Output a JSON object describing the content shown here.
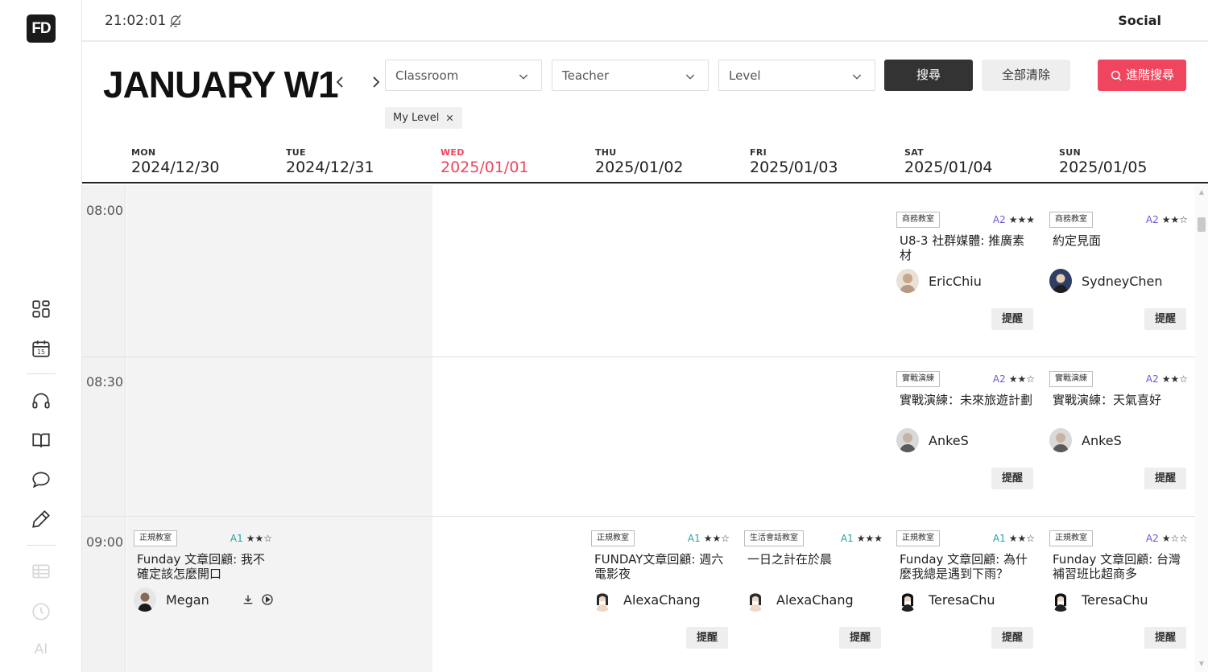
{
  "sidebar": {
    "logo": "FD",
    "ai_label": "AI",
    "icons": [
      "dashboard-icon",
      "calendar-icon",
      "headphones-icon",
      "book-icon",
      "chat-icon",
      "pencil-icon",
      "table-icon",
      "clock-icon"
    ]
  },
  "topbar": {
    "time": "21:02:01",
    "social": "Social"
  },
  "toolbar": {
    "week_title": "JANUARY W1",
    "classroom_placeholder": "Classroom",
    "teacher_placeholder": "Teacher",
    "level_placeholder": "Level",
    "search_label": "搜尋",
    "clear_label": "全部清除",
    "advanced_label": "進階搜尋",
    "chip_label": "My Level"
  },
  "days": [
    {
      "name": "MON",
      "date": "2024/12/30"
    },
    {
      "name": "TUE",
      "date": "2024/12/31"
    },
    {
      "name": "WED",
      "date": "2025/01/01"
    },
    {
      "name": "THU",
      "date": "2025/01/02"
    },
    {
      "name": "FRI",
      "date": "2025/01/03"
    },
    {
      "name": "SAT",
      "date": "2025/01/04"
    },
    {
      "name": "SUN",
      "date": "2025/01/05"
    }
  ],
  "times": [
    "08:00",
    "08:30",
    "09:00"
  ],
  "remind_label": "提醒",
  "cards": [
    {
      "tag": "商務教室",
      "level": "A2",
      "stars": "★★★",
      "title": "U8-3 社群媒體: 推廣素材",
      "teacher": "EricChiu"
    },
    {
      "tag": "商務教室",
      "level": "A2",
      "stars": "★★☆",
      "title": "約定見面",
      "teacher": "SydneyChen"
    },
    {
      "tag": "實戰演練",
      "level": "A2",
      "stars": "★★☆",
      "title": "實戰演練：未來旅遊計劃",
      "teacher": "AnkeS"
    },
    {
      "tag": "實戰演練",
      "level": "A2",
      "stars": "★★☆",
      "title": "實戰演練：天氣喜好",
      "teacher": "AnkeS"
    },
    {
      "tag": "正規教室",
      "level": "A1",
      "stars": "★★☆",
      "title": "Funday 文章回顧: 我不確定該怎麼開口",
      "teacher": "Megan"
    },
    {
      "tag": "正規教室",
      "level": "A1",
      "stars": "★★☆",
      "title": "FUNDAY文章回顧: 週六電影夜",
      "teacher": "AlexaChang"
    },
    {
      "tag": "生活會話教室",
      "level": "A1",
      "stars": "★★★",
      "title": "一日之計在於晨",
      "teacher": "AlexaChang"
    },
    {
      "tag": "正規教室",
      "level": "A1",
      "stars": "★★☆",
      "title": "Funday 文章回顧: 為什麼我總是遇到下雨？",
      "teacher": "TeresaChu"
    },
    {
      "tag": "正規教室",
      "level": "A2",
      "stars": "★☆☆",
      "title": "Funday 文章回顧: 台灣補習班比超商多",
      "teacher": "TeresaChu"
    }
  ]
}
